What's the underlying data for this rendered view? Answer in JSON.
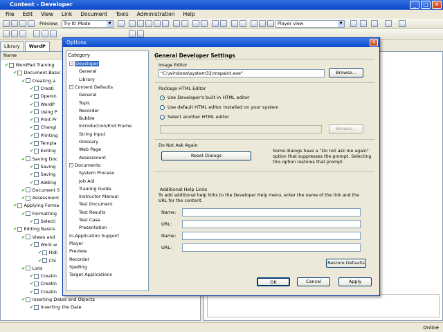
{
  "window": {
    "title": "Content - Developer",
    "min": "_",
    "max": "□",
    "close": "✕"
  },
  "menu": [
    "File",
    "Edit",
    "View",
    "Link",
    "Document",
    "Tools",
    "Administration",
    "Help"
  ],
  "toolbar": {
    "preview_label": "Preview:",
    "preview_mode": "Try It! Mode",
    "player_view": "Player view"
  },
  "tabs": [
    "Library",
    "WordP"
  ],
  "outline_header": "Name",
  "tree": [
    {
      "t": "WordPad Training",
      "l": 0
    },
    {
      "t": "Document Basic",
      "l": 1
    },
    {
      "t": "Creating a",
      "l": 2
    },
    {
      "t": "Creati",
      "l": 3
    },
    {
      "t": "Openin",
      "l": 3
    },
    {
      "t": "WordP",
      "l": 3
    },
    {
      "t": "Using P",
      "l": 3
    },
    {
      "t": "Print Pr",
      "l": 3
    },
    {
      "t": "Changi",
      "l": 3
    },
    {
      "t": "Printing",
      "l": 3
    },
    {
      "t": "Templa",
      "l": 3
    },
    {
      "t": "Exiting",
      "l": 3
    },
    {
      "t": "Saving Doc",
      "l": 2
    },
    {
      "t": "Saving",
      "l": 3
    },
    {
      "t": "Saving",
      "l": 3
    },
    {
      "t": "Adding",
      "l": 3
    },
    {
      "t": "Document S",
      "l": 2
    },
    {
      "t": "Assessment",
      "l": 2
    },
    {
      "t": "Applying Forma",
      "l": 1
    },
    {
      "t": "Formatting",
      "l": 2
    },
    {
      "t": "Selecti",
      "l": 3
    },
    {
      "t": "Editing Basics",
      "l": 1
    },
    {
      "t": "Views and",
      "l": 2
    },
    {
      "t": "Work w",
      "l": 3
    },
    {
      "t": "Hidi",
      "l": 4
    },
    {
      "t": "Chi",
      "l": 4
    },
    {
      "t": "Lists",
      "l": 2
    },
    {
      "t": "Creatin",
      "l": 3
    },
    {
      "t": "Creatin",
      "l": 3
    },
    {
      "t": "Creatin",
      "l": 3
    },
    {
      "t": "Inserting Dates and Objects",
      "l": 2
    },
    {
      "t": "Inserting the Date",
      "l": 3
    }
  ],
  "status": {
    "text": "Online"
  },
  "dialog": {
    "title": "Options",
    "close": "X",
    "category_label": "Category",
    "categories": [
      {
        "t": "Developer",
        "l": 0,
        "exp": "-",
        "sel": true
      },
      {
        "t": "General",
        "l": 1
      },
      {
        "t": "Library",
        "l": 1
      },
      {
        "t": "Content Defaults",
        "l": 0,
        "exp": "-"
      },
      {
        "t": "General",
        "l": 1
      },
      {
        "t": "Topic",
        "l": 1
      },
      {
        "t": "Recorder",
        "l": 1
      },
      {
        "t": "Bubble",
        "l": 1
      },
      {
        "t": "Introduction/End Frame",
        "l": 1
      },
      {
        "t": "String Input",
        "l": 1
      },
      {
        "t": "Glossary",
        "l": 1
      },
      {
        "t": "Web Page",
        "l": 1
      },
      {
        "t": "Assessment",
        "l": 1
      },
      {
        "t": "Documents",
        "l": 0,
        "exp": "-"
      },
      {
        "t": "System Process",
        "l": 1
      },
      {
        "t": "Job Aid",
        "l": 1
      },
      {
        "t": "Training Guide",
        "l": 1
      },
      {
        "t": "Instructor Manual",
        "l": 1
      },
      {
        "t": "Test Document",
        "l": 1
      },
      {
        "t": "Test Results",
        "l": 1
      },
      {
        "t": "Test Case",
        "l": 1
      },
      {
        "t": "Presentation",
        "l": 1
      },
      {
        "t": "In-Application Support",
        "l": 0
      },
      {
        "t": "Player",
        "l": 0
      },
      {
        "t": "Preview",
        "l": 0
      },
      {
        "t": "Recorder",
        "l": 0
      },
      {
        "t": "Spelling",
        "l": 0
      },
      {
        "t": "Target Applications",
        "l": 0
      }
    ],
    "heading": "General Developer Settings",
    "image_editor": {
      "label": "Image Editor",
      "value": "\"C:\\windows\\system32\\mspaint.exe\"",
      "browse": "Browse..."
    },
    "package": {
      "label": "Package HTML Editor",
      "options": [
        "Use Developer's built in HTML editor",
        "Use default HTML editor installed on your system",
        "Select another HTML editor"
      ],
      "selected": 0,
      "browse": "Browse..."
    },
    "dnaa": {
      "label": "Do Not Ask Again",
      "reset": "Reset Dialogs",
      "desc": "Some dialogs have a \"Do not ask me again\" option that suppresses the prompt. Selecting this option restores that prompt."
    },
    "help_links": {
      "label": "Additional Help Links",
      "desc": "To add additional help links to the Developer Help menu, enter the name of the link and the URL for the content.",
      "name": "Name:",
      "url": "URL:"
    },
    "restore": "Restore Defaults",
    "ok": "OK",
    "cancel": "Cancel",
    "apply": "Apply"
  },
  "colors": {
    "titlebar": "#0a48c8",
    "selection": "#316ac5",
    "check": "#1a9a1a"
  }
}
